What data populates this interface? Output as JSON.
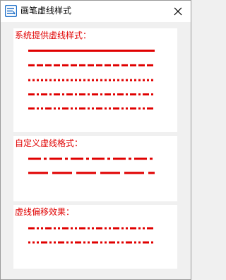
{
  "window": {
    "title": "画笔虚线样式",
    "close_glyph": "✕"
  },
  "panels": {
    "system": {
      "label": "系统提供虚线样式："
    },
    "custom": {
      "label": "自定义虚线格式："
    },
    "offset": {
      "label": "虚线偏移效果："
    }
  },
  "colors": {
    "accent": "#e00000",
    "panel_bg": "#ffffff",
    "window_bg": "#f0f0f0",
    "icon_blue": "#1e6fc7"
  }
}
